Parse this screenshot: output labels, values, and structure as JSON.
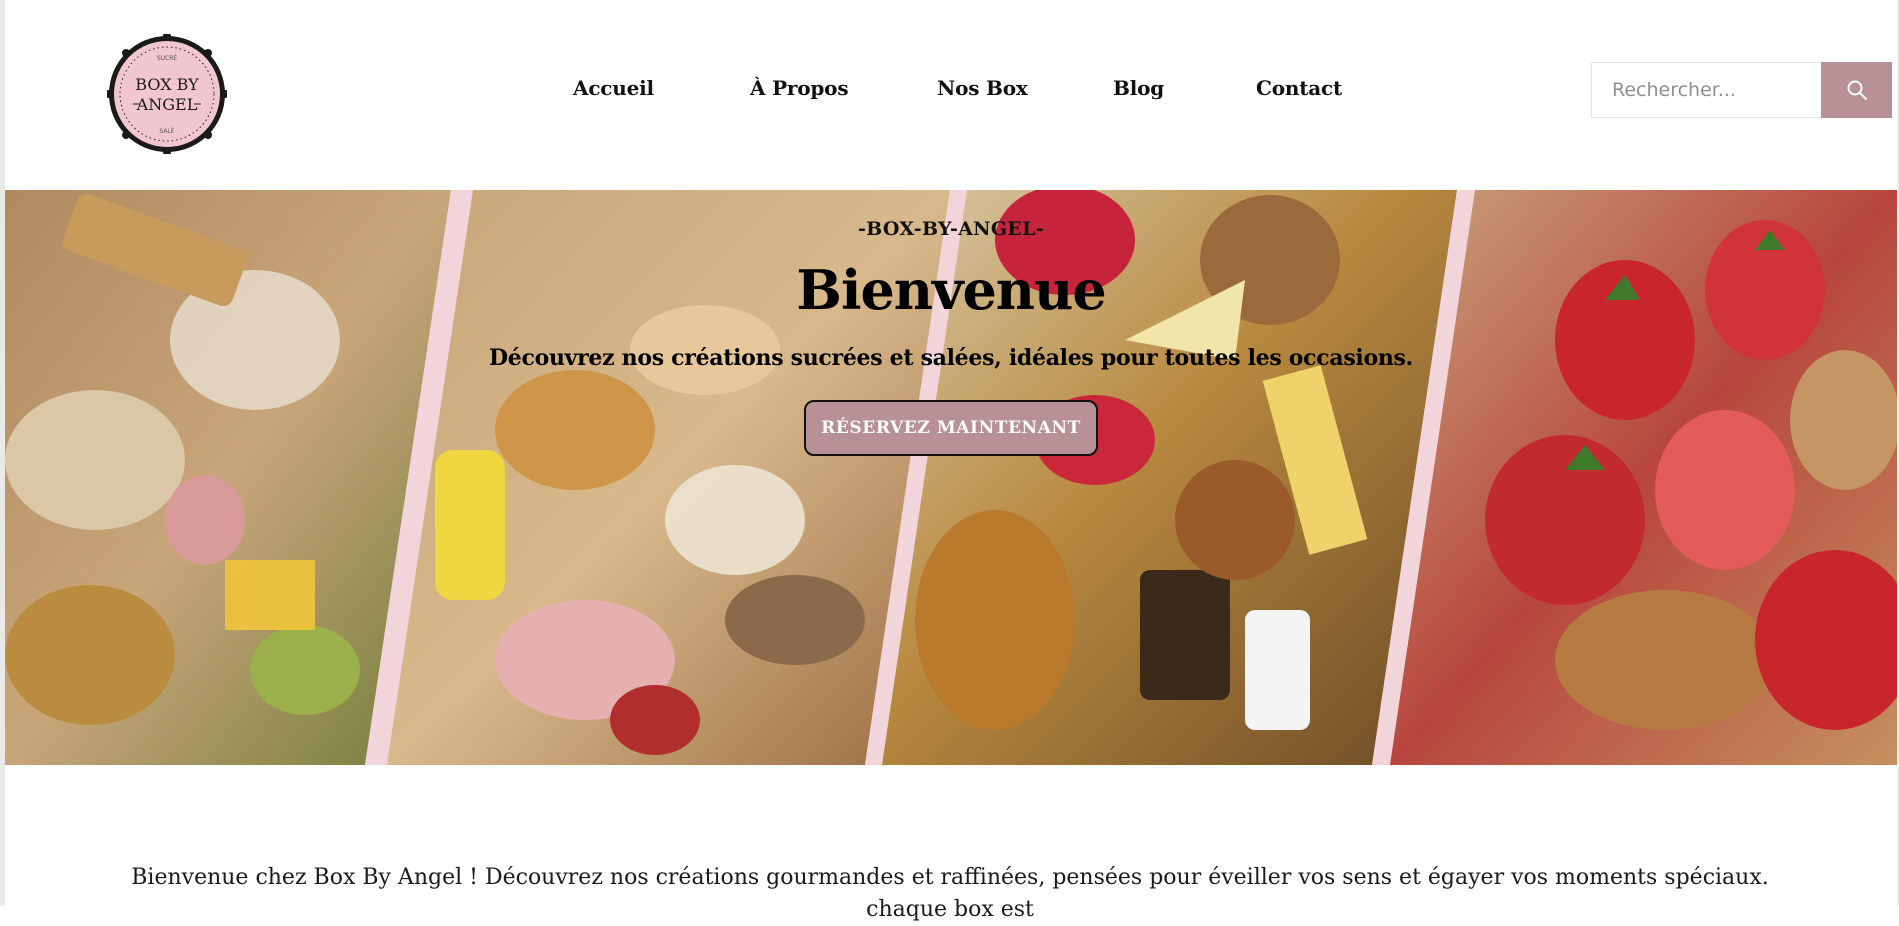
{
  "logo": {
    "top_arc_text": "SUCRÉ",
    "line1": "BOX BY",
    "line2": "ANGEL",
    "bottom_arc_text": "SALÉ",
    "colors": {
      "fill": "#f2c6cf",
      "ring": "#1a1a1a"
    }
  },
  "nav": {
    "items": [
      {
        "label": "Accueil"
      },
      {
        "label": "À Propos"
      },
      {
        "label": "Nos Box"
      },
      {
        "label": "Blog"
      },
      {
        "label": "Contact"
      }
    ]
  },
  "search": {
    "placeholder": "Rechercher...",
    "button_icon": "search-icon"
  },
  "hero": {
    "kicker": "-BOX-BY-ANGEL-",
    "title": "Bienvenue",
    "subtitle": "Découvrez nos créations sucrées et salées, idéales pour toutes les occasions.",
    "cta_label": "RÉSERVEZ MAINTENANT",
    "panels": [
      {
        "subject": "brunch-box-photo"
      },
      {
        "subject": "viennoiserie-box-photo"
      },
      {
        "subject": "apero-snack-box-photo"
      },
      {
        "subject": "strawberry-speculoos-cake-photo"
      }
    ]
  },
  "intro": {
    "text": "Bienvenue chez Box By Angel ! Découvrez nos créations gourmandes et raffinées, pensées pour éveiller vos sens et égayer vos moments spéciaux. chaque box est"
  },
  "colors": {
    "accent": "#b89196",
    "divider_pink": "#f2d4db",
    "text": "#111111"
  }
}
